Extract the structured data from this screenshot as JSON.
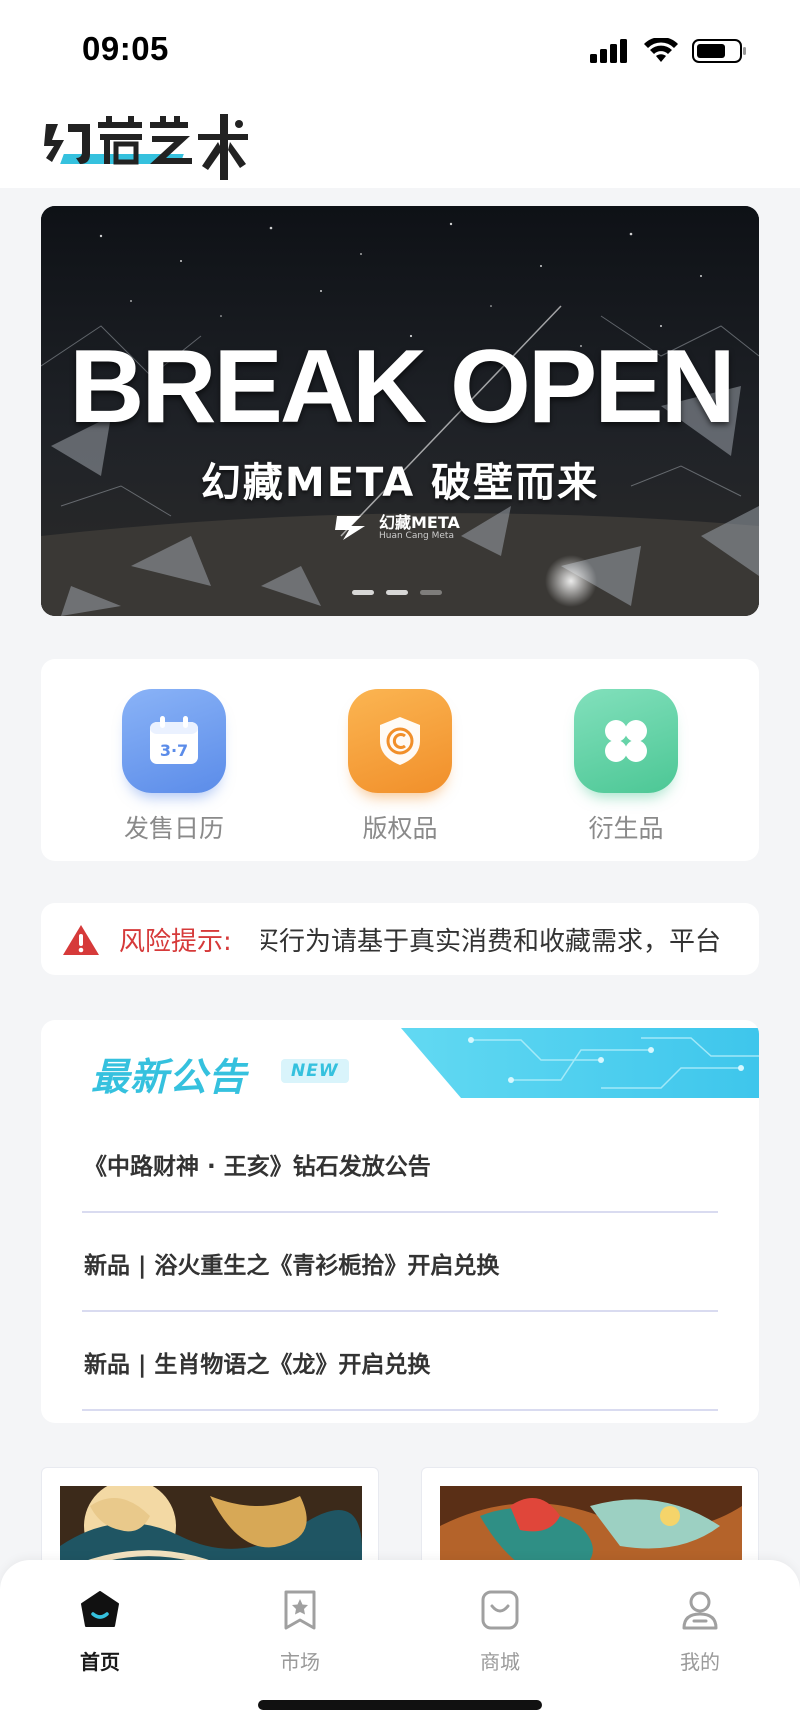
{
  "status_bar": {
    "time": "09:05"
  },
  "header": {
    "app_name": "幻藏艺术"
  },
  "banner": {
    "headline": "BREAK OPEN",
    "subtitle": "幻藏META 破壁而来",
    "brand_name": "幻藏META",
    "brand_en": "Huan Cang Meta",
    "slides": [
      true,
      false,
      false
    ]
  },
  "quick_actions": [
    {
      "label": "发售日历",
      "icon": "calendar-icon",
      "color": "#6b9bf0",
      "badge": "3·7"
    },
    {
      "label": "版权品",
      "icon": "copyright-shield-icon",
      "color": "#f5a03a"
    },
    {
      "label": "衍生品",
      "icon": "clover-icon",
      "color": "#5fd3a6"
    }
  ],
  "risk_notice": {
    "label": "风险提示:",
    "text": "买行为请基于真实消费和收藏需求，平台"
  },
  "announcements": {
    "title": "最新公告",
    "badge": "NEW",
    "items": [
      "《中路财神 · 王亥》钻石发放公告",
      "新品 | 浴火重生之《青衫栀拾》开启兑换",
      "新品 | 生肖物语之《龙》开启兑换"
    ]
  },
  "tab_bar": {
    "tabs": [
      {
        "label": "首页",
        "icon": "home-icon",
        "active": true
      },
      {
        "label": "市场",
        "icon": "market-icon",
        "active": false
      },
      {
        "label": "商城",
        "icon": "shop-bag-icon",
        "active": false
      },
      {
        "label": "我的",
        "icon": "profile-icon",
        "active": false
      }
    ]
  },
  "colors": {
    "accent": "#35c1de",
    "risk": "#d63a3a",
    "background": "#f4f5f7"
  }
}
